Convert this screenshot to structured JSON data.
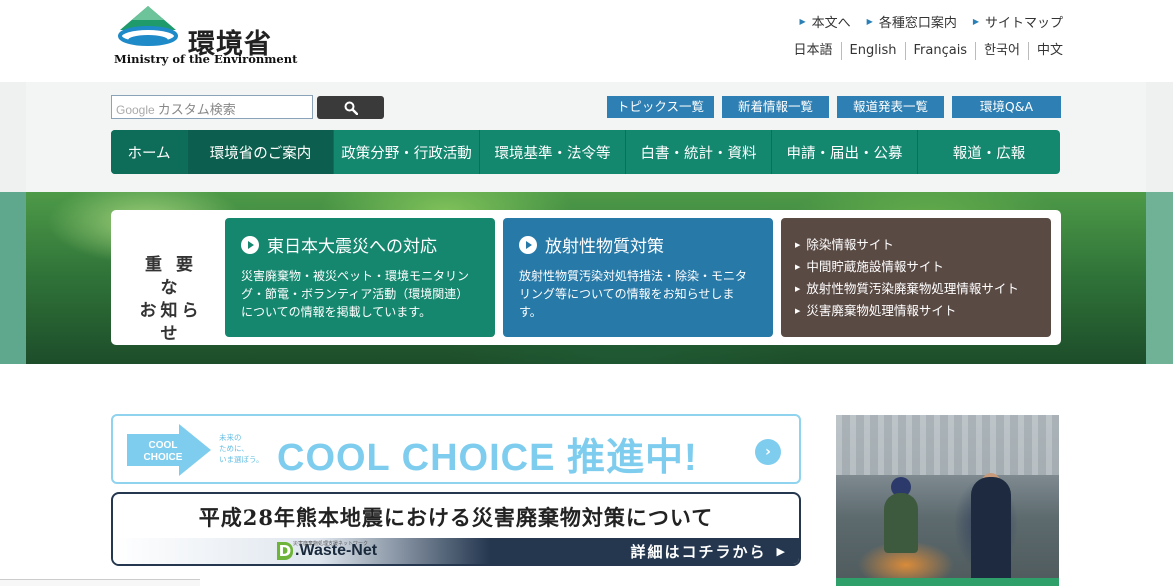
{
  "header": {
    "logo_jp": "環境省",
    "logo_en": "Ministry of the Environment",
    "util_links": [
      "本文へ",
      "各種窓口案内",
      "サイトマップ"
    ],
    "lang_links": [
      "日本語",
      "English",
      "Français",
      "한국어",
      "中文"
    ]
  },
  "search": {
    "google_label": "Google",
    "placeholder": "カスタム検索"
  },
  "quick_links": [
    "トピックス一覧",
    "新着情報一覧",
    "報道発表一覧",
    "環境Q&A"
  ],
  "nav": {
    "items": [
      "ホーム",
      "環境省のご案内",
      "政策分野・行政活動",
      "環境基準・法令等",
      "白書・統計・資料",
      "申請・届出・公募",
      "報道・広報"
    ]
  },
  "notice": {
    "label_line1": "重 要 な",
    "label_line2": "お知らせ",
    "card1": {
      "title": "東日本大震災への対応",
      "desc": "災害廃棄物・被災ペット・環境モニタリング・節電・ボランティア活動（環境関連）についての情報を掲載しています。"
    },
    "card2": {
      "title": "放射性物質対策",
      "desc": "放射性物質汚染対処特措法・除染・モニタリング等についての情報をお知らせします。"
    },
    "card3": {
      "links": [
        "除染情報サイト",
        "中間貯蔵施設情報サイト",
        "放射性物質汚染廃棄物処理情報サイト",
        "災害廃棄物処理情報サイト"
      ]
    }
  },
  "banners": {
    "cool_badge_line1": "COOL",
    "cool_badge_line2": "CHOICE",
    "cool_small_line1": "未来の",
    "cool_small_line2": "ために、",
    "cool_small_line3": "いま選ぼう。",
    "cool_text": "COOL CHOICE 推進中!",
    "quake_title": "平成28年熊本地震における災害廃棄物対策について",
    "quake_logo_tiny": "災害廃棄物処理支援ネットワーク",
    "quake_logo_d": "D",
    "quake_logo_w": ".Waste-Net",
    "quake_more": "詳細はコチラから"
  },
  "colors": {
    "nav_green": "#14876f",
    "link_blue": "#2d7fb4",
    "card_brown": "#5a4a44",
    "cool_blue": "#7fcdee",
    "quake_navy": "#24374f"
  }
}
